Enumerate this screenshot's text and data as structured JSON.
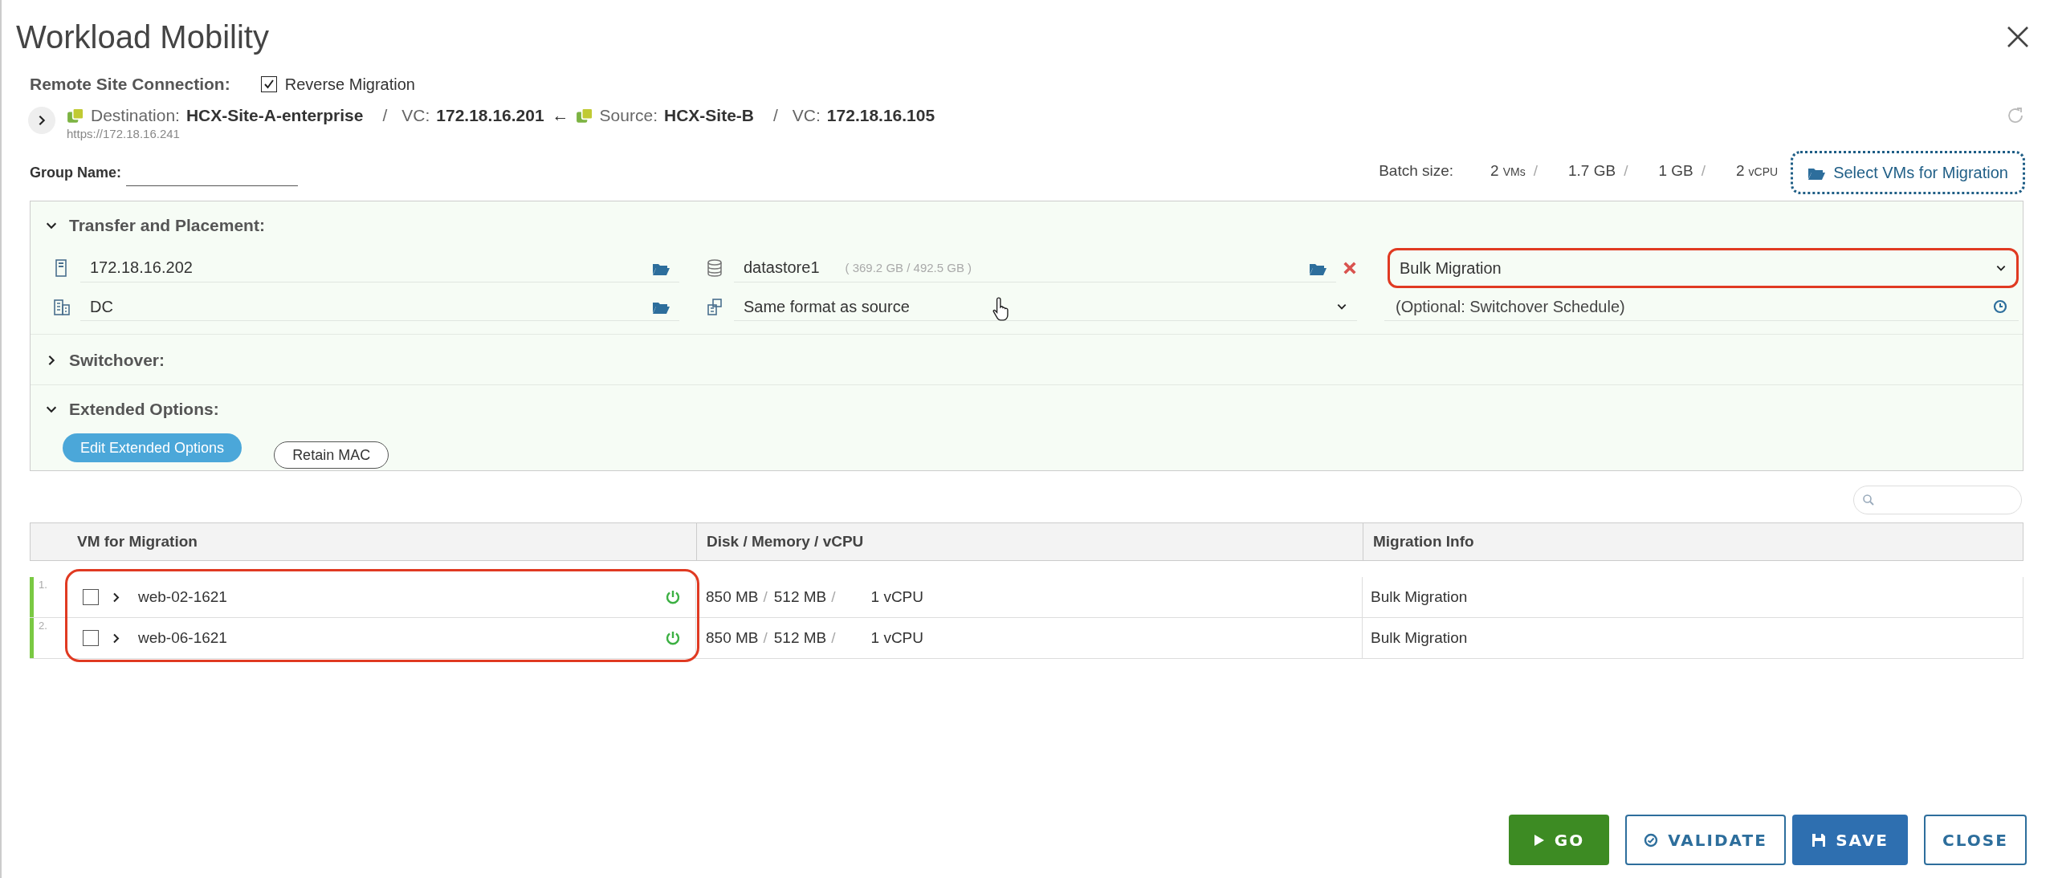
{
  "window": {
    "title": "Workload Mobility"
  },
  "remote_site": {
    "label": "Remote Site Connection:",
    "reverse_migration": {
      "label": "Reverse Migration",
      "checked": true
    }
  },
  "connection": {
    "expanded": false,
    "destination": {
      "label": "Destination:",
      "site": "HCX-Site-A-enterprise",
      "sep": "/",
      "vc_label": "VC:",
      "vc": "172.18.16.201"
    },
    "arrow": "←",
    "source": {
      "label": "Source:",
      "site": "HCX-Site-B",
      "sep": "/",
      "vc_label": "VC:",
      "vc": "172.18.16.105"
    },
    "url": "https://172.18.16.241"
  },
  "group_name": {
    "label": "Group Name:"
  },
  "batch": {
    "label": "Batch size:",
    "items": [
      {
        "value": "2",
        "unit": "VMs",
        "sep": "/"
      },
      {
        "value": "1.7 GB",
        "sep": "/"
      },
      {
        "value": "1 GB",
        "sep": "/"
      },
      {
        "value": "2",
        "unit": "vCPU"
      }
    ]
  },
  "select_vms_button": {
    "label": "Select VMs for Migration"
  },
  "sections": [
    {
      "kind": "placement",
      "title": "Transfer and Placement:",
      "expanded": true,
      "fields": [
        {
          "kind": "host",
          "value": "172.18.16.202"
        },
        {
          "kind": "datastore",
          "value": "datastore1",
          "detail": "( 369.2 GB / 492.5 GB )"
        },
        {
          "kind": "migration_type",
          "value": "Bulk Migration",
          "highlighted": true
        },
        {
          "kind": "folder",
          "value": "DC"
        },
        {
          "kind": "format",
          "value": "Same format as source"
        },
        {
          "kind": "schedule",
          "placeholder": "(Optional: Switchover Schedule)"
        }
      ]
    },
    {
      "kind": "plain",
      "title": "Switchover:",
      "expanded": false
    },
    {
      "kind": "options",
      "title": "Extended Options:",
      "expanded": true,
      "buttons": [
        {
          "label": "Edit Extended Options",
          "primary": true
        },
        {
          "label": "Retain MAC",
          "primary": false
        }
      ]
    }
  ],
  "table": {
    "columns": [
      "VM for Migration",
      "Disk / Memory / vCPU",
      "Migration Info"
    ],
    "names_highlighted": true,
    "rows": [
      {
        "index": "1.",
        "checked": false,
        "expanded": false,
        "name": "web-02-1621",
        "powered_on": true,
        "resources": [
          {
            "text": "850 MB",
            "sep": "/"
          },
          {
            "text": "512 MB",
            "sep": "/"
          },
          {
            "text": "1 vCPU"
          }
        ],
        "info": "Bulk Migration"
      },
      {
        "index": "2.",
        "checked": false,
        "expanded": false,
        "name": "web-06-1621",
        "powered_on": true,
        "resources": [
          {
            "text": "850 MB",
            "sep": "/"
          },
          {
            "text": "512 MB",
            "sep": "/"
          },
          {
            "text": "1 vCPU"
          }
        ],
        "info": "Bulk Migration"
      }
    ]
  },
  "footer_buttons": [
    {
      "kind": "go",
      "label": "GO"
    },
    {
      "kind": "validate",
      "label": "VALIDATE"
    },
    {
      "kind": "save",
      "label": "SAVE"
    },
    {
      "kind": "close",
      "label": "CLOSE"
    }
  ]
}
